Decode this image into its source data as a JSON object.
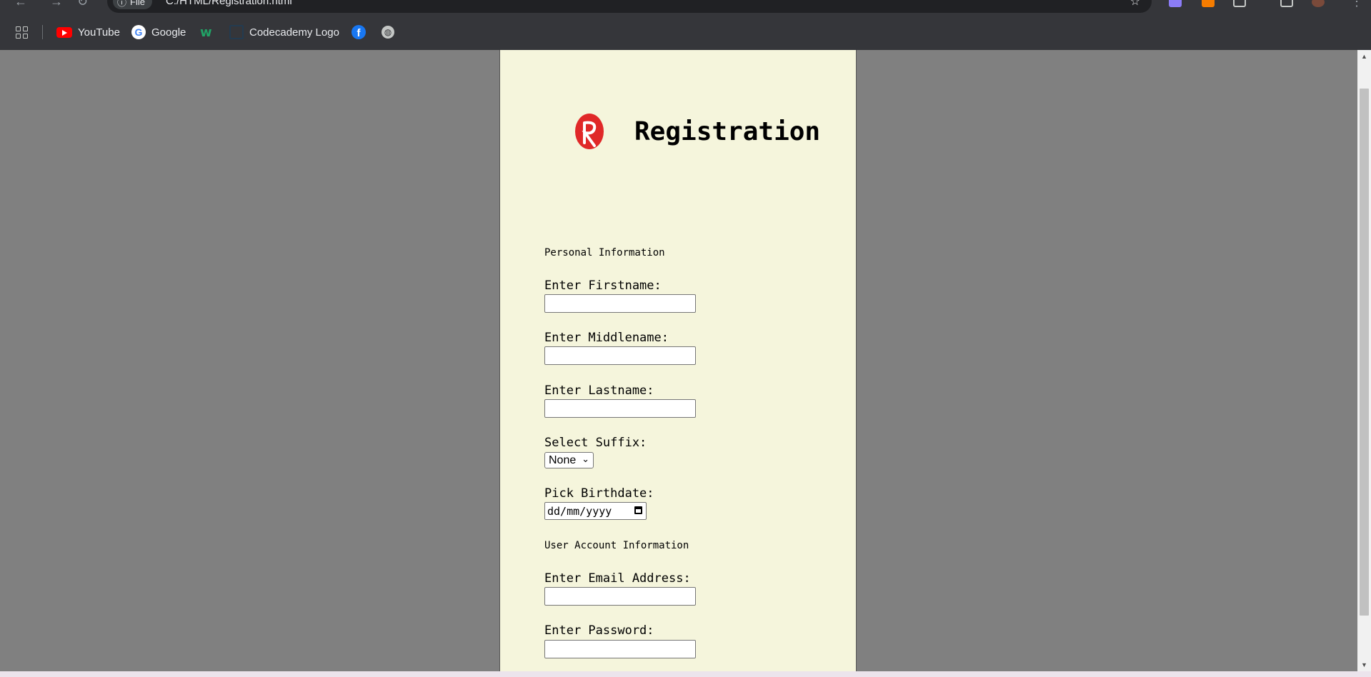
{
  "browser": {
    "site_chip": "File",
    "url": "C:/HTML/Registration.html",
    "bookmarks": [
      "YouTube",
      "Google",
      "Codecademy Logo"
    ]
  },
  "page": {
    "title": "Registration",
    "sections": {
      "personal": "Personal Information",
      "account": "User Account Information"
    },
    "labels": {
      "firstname": "Enter Firstname:",
      "middlename": "Enter Middlename:",
      "lastname": "Enter Lastname:",
      "suffix": "Select Suffix:",
      "birthdate": "Pick Birthdate:",
      "email": "Enter Email Address:",
      "password": "Enter Password:"
    },
    "suffix_value": "None",
    "birthdate_placeholder": "dd/mm/yyyy"
  },
  "colors": {
    "panel_bg": "#f5f5dc",
    "page_bg": "#808080",
    "logo_red": "#e02828"
  }
}
